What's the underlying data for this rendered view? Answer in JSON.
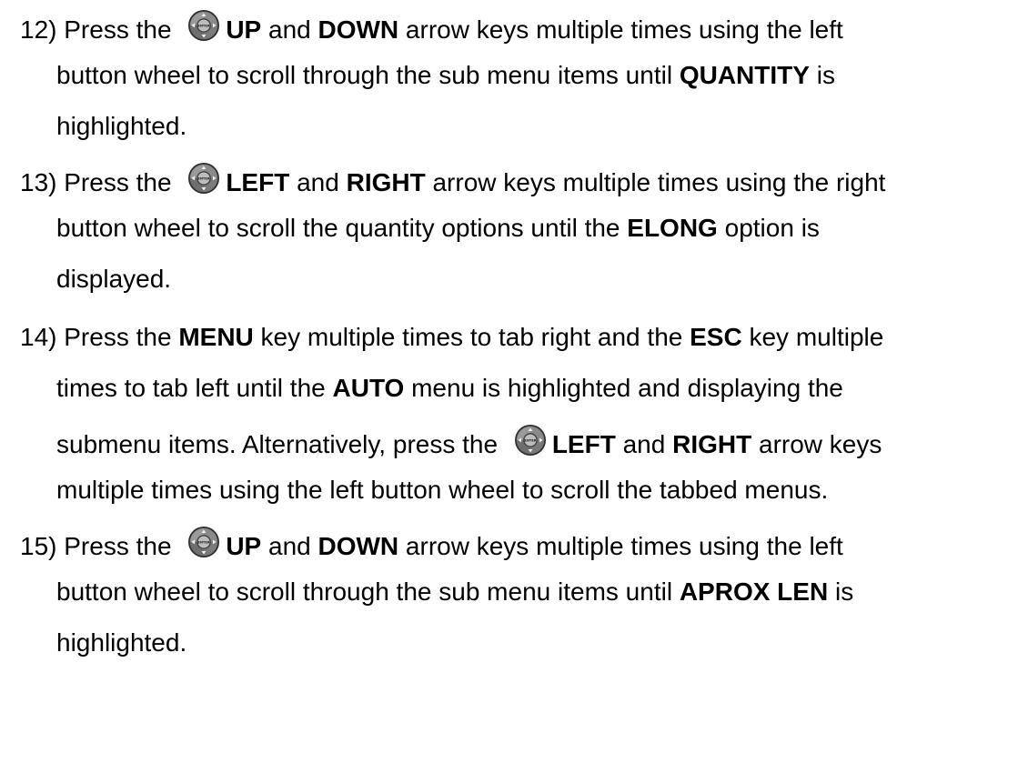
{
  "steps": [
    {
      "number": "12)",
      "lines": [
        {
          "t1": " Press the ",
          "k1": "UP",
          "t2": " and ",
          "k2": "DOWN",
          "t3": " arrow keys multiple times using the left"
        },
        {
          "t1": "button wheel to scroll through the sub menu items until ",
          "k1": "QUANTITY",
          "t2": " is"
        },
        {
          "t1": "highlighted."
        }
      ]
    },
    {
      "number": "13)",
      "lines": [
        {
          "t1": " Press the ",
          "k1": "LEFT",
          "t2": " and ",
          "k2": "RIGHT",
          "t3": " arrow keys multiple times using the right"
        },
        {
          "t1": "button wheel to scroll the quantity options until the ",
          "k1": "ELONG",
          "t2": " option is"
        },
        {
          "t1": "displayed."
        }
      ]
    },
    {
      "number": "14)",
      "lines": [
        {
          "t1": " Press the ",
          "k1": "MENU",
          "t2": " key multiple times to tab right and the ",
          "k2": "ESC",
          "t3": " key multiple"
        },
        {
          "t1": "times to tab left until the ",
          "k1": "AUTO",
          "t2": " menu is highlighted and displaying the"
        },
        {
          "t1": "submenu items.  Alternatively, press the ",
          "k1": "LEFT",
          "t2": " and ",
          "k2": "RIGHT",
          "t3": " arrow keys"
        },
        {
          "t1": "multiple times using the left button wheel to scroll the tabbed menus."
        }
      ]
    },
    {
      "number": "15)",
      "lines": [
        {
          "t1": " Press the ",
          "k1": "UP",
          "t2": " and ",
          "k2": "DOWN",
          "t3": " arrow keys multiple times using the left"
        },
        {
          "t1": "button wheel to scroll through the sub menu items until ",
          "k1": "APROX LEN",
          "t2": " is"
        },
        {
          "t1": "highlighted."
        }
      ]
    }
  ],
  "icons": {
    "button_wheel": "button-wheel-icon",
    "wheel_center_label": "ENTER"
  }
}
